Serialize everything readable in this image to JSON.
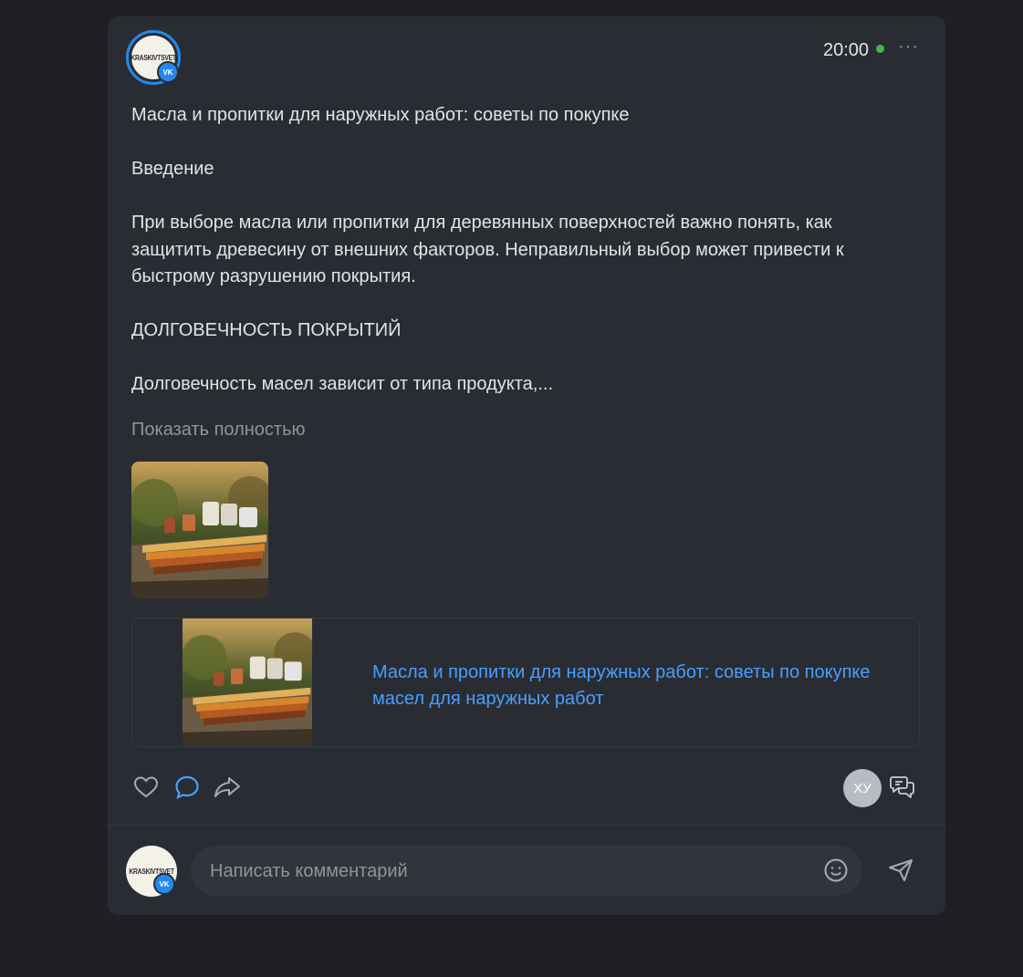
{
  "post": {
    "author_logo_text": "KRASKIVTSVET",
    "vk_badge": "VK",
    "time": "20:00",
    "more_label": "···",
    "text": {
      "title": "Масла и пропитки для наружных работ: советы по покупке",
      "intro_heading": "Введение",
      "intro_body": "При выборе масла или пропитки для деревянных поверхностей важно понять, как защитить древесину от внешних факторов. Неправильный выбор может привести к быстрому разрушению покрытия.",
      "section_heading": "ДОЛГОВЕЧНОСТЬ ПОКРЫТИЙ",
      "section_body": "Долговечность масел зависит от типа продукта,..."
    },
    "show_more": "Показать полностью",
    "link": {
      "title": "Масла и пропитки для наружных работ: советы по покупке масел для наружных работ"
    },
    "actions": {
      "like_icon": "heart-icon",
      "comment_icon": "comment-icon",
      "share_icon": "share-icon",
      "viewer_initials": "ХУ",
      "discussion_icon": "chat-bubbles-icon"
    }
  },
  "comment": {
    "placeholder": "Написать комментарий",
    "emoji_icon": "smile-icon",
    "send_icon": "send-icon"
  },
  "colors": {
    "background": "#1e2023",
    "card": "#292d33",
    "accent": "#2688eb",
    "link": "#4a9eff",
    "online": "#4bb34b",
    "muted": "#939393"
  }
}
